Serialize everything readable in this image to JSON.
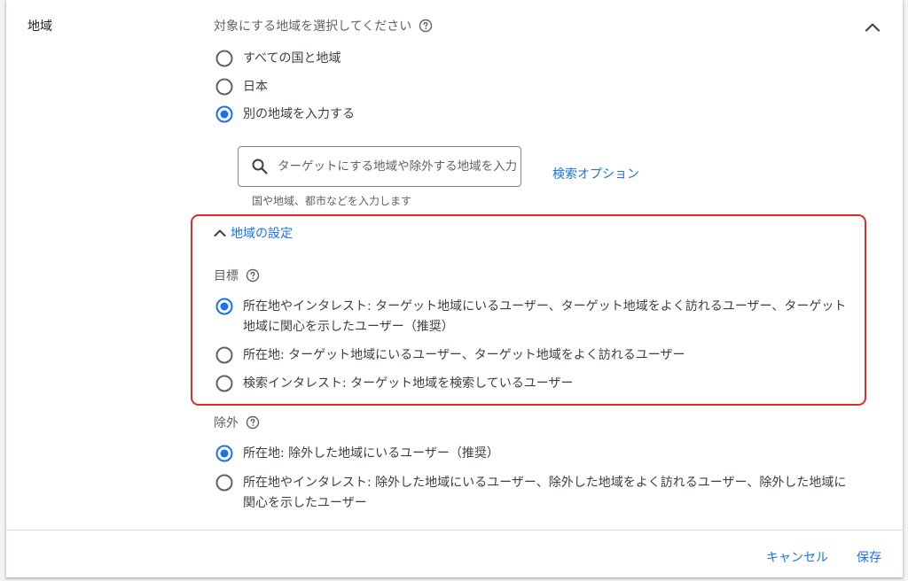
{
  "section": {
    "label": "地域",
    "instruction": "対象にする地域を選択してください"
  },
  "target_options": [
    {
      "label": "すべての国と地域",
      "selected": false
    },
    {
      "label": "日本",
      "selected": false
    },
    {
      "label": "別の地域を入力する",
      "selected": true
    }
  ],
  "search": {
    "placeholder": "ターゲットにする地域や除外する地域を入力",
    "hint": "国や地域、都市などを入力します",
    "options_link": "検索オプション"
  },
  "location_settings": {
    "toggle_label": "地域の設定",
    "goal": {
      "label": "目標",
      "options": [
        {
          "line1": "所在地やインタレスト: ターゲット地域にいるユーザー、ターゲット地域をよく訪れるユーザー、ターゲット",
          "line2": "地域に関心を示したユーザー（推奨）",
          "selected": true
        },
        {
          "line1": "所在地: ターゲット地域にいるユーザー、ターゲット地域をよく訪れるユーザー",
          "selected": false
        },
        {
          "line1": "検索インタレスト: ターゲット地域を検索しているユーザー",
          "selected": false
        }
      ]
    },
    "exclusion": {
      "label": "除外",
      "options": [
        {
          "line1": "所在地: 除外した地域にいるユーザー（推奨）",
          "selected": true
        },
        {
          "line1": "所在地やインタレスト: 除外した地域にいるユーザー、除外した地域をよく訪れるユーザー、除外した地域に",
          "line2": "関心を示したユーザー",
          "selected": false
        }
      ]
    }
  },
  "footer": {
    "cancel_label": "キャンセル",
    "save_label": "保存"
  },
  "colors": {
    "accent": "#1a73e8",
    "highlight_border": "#d93025",
    "text": "#3c4043",
    "secondary_text": "#5f6368"
  },
  "icons": {
    "help": "help-circle-icon",
    "collapse": "chevron-up-icon",
    "search": "search-icon"
  }
}
